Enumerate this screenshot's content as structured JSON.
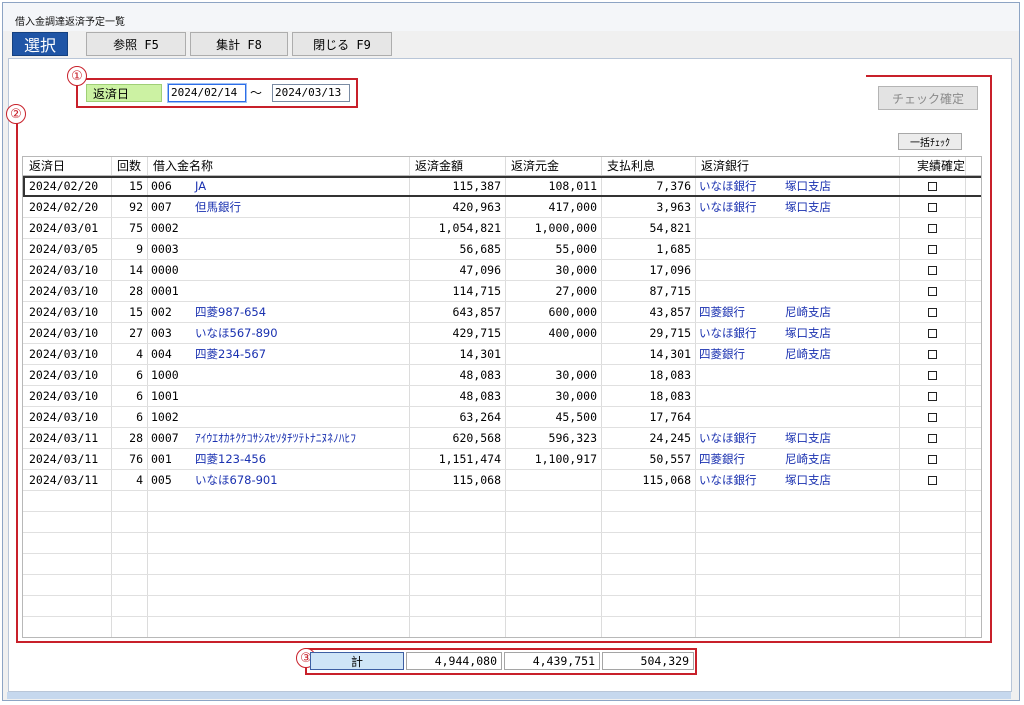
{
  "window": {
    "title": "借入金調達返済予定一覧"
  },
  "toolbar": {
    "select_label": "選択",
    "refer_label": "参照 F5",
    "aggregate_label": "集計 F8",
    "close_label": "閉じる F9"
  },
  "markers": {
    "m1": "①",
    "m2": "②",
    "m3": "③"
  },
  "filter": {
    "label": "返済日",
    "from": "2024/02/14",
    "tilde": "～",
    "to": "2024/03/13"
  },
  "buttons": {
    "check_confirm": "チェック確定",
    "bulk_check": "一括ﾁｪｯｸ"
  },
  "table": {
    "headers": [
      "返済日",
      "回数",
      "借入金名称",
      "返済金額",
      "返済元金",
      "支払利息",
      "返済銀行",
      "実績確定"
    ],
    "rows": [
      {
        "date": "2024/02/20",
        "count": "15",
        "code": "006",
        "name": "JA",
        "amount": "115,387",
        "principal": "108,011",
        "interest": "7,376",
        "bank": "いなほ銀行",
        "branch": "塚口支店"
      },
      {
        "date": "2024/02/20",
        "count": "92",
        "code": "007",
        "name": "但馬銀行",
        "amount": "420,963",
        "principal": "417,000",
        "interest": "3,963",
        "bank": "いなほ銀行",
        "branch": "塚口支店"
      },
      {
        "date": "2024/03/01",
        "count": "75",
        "code": "0002",
        "name": "",
        "amount": "1,054,821",
        "principal": "1,000,000",
        "interest": "54,821",
        "bank": "",
        "branch": ""
      },
      {
        "date": "2024/03/05",
        "count": "9",
        "code": "0003",
        "name": "",
        "amount": "56,685",
        "principal": "55,000",
        "interest": "1,685",
        "bank": "",
        "branch": ""
      },
      {
        "date": "2024/03/10",
        "count": "14",
        "code": "0000",
        "name": "",
        "amount": "47,096",
        "principal": "30,000",
        "interest": "17,096",
        "bank": "",
        "branch": ""
      },
      {
        "date": "2024/03/10",
        "count": "28",
        "code": "0001",
        "name": "",
        "amount": "114,715",
        "principal": "27,000",
        "interest": "87,715",
        "bank": "",
        "branch": ""
      },
      {
        "date": "2024/03/10",
        "count": "15",
        "code": "002",
        "name": "四菱987-654",
        "amount": "643,857",
        "principal": "600,000",
        "interest": "43,857",
        "bank": "四菱銀行",
        "branch": "尼崎支店"
      },
      {
        "date": "2024/03/10",
        "count": "27",
        "code": "003",
        "name": "いなほ567-890",
        "amount": "429,715",
        "principal": "400,000",
        "interest": "29,715",
        "bank": "いなほ銀行",
        "branch": "塚口支店"
      },
      {
        "date": "2024/03/10",
        "count": "4",
        "code": "004",
        "name": "四菱234-567",
        "amount": "14,301",
        "principal": "",
        "interest": "14,301",
        "bank": "四菱銀行",
        "branch": "尼崎支店"
      },
      {
        "date": "2024/03/10",
        "count": "6",
        "code": "1000",
        "name": "",
        "amount": "48,083",
        "principal": "30,000",
        "interest": "18,083",
        "bank": "",
        "branch": ""
      },
      {
        "date": "2024/03/10",
        "count": "6",
        "code": "1001",
        "name": "",
        "amount": "48,083",
        "principal": "30,000",
        "interest": "18,083",
        "bank": "",
        "branch": ""
      },
      {
        "date": "2024/03/10",
        "count": "6",
        "code": "1002",
        "name": "",
        "amount": "63,264",
        "principal": "45,500",
        "interest": "17,764",
        "bank": "",
        "branch": ""
      },
      {
        "date": "2024/03/11",
        "count": "28",
        "code": "0007",
        "name": "ｱｲｳｴｵｶｷｸｹｺｻｼｽｾｿﾀﾁﾂﾃﾄﾅﾆﾇﾈﾉﾊﾋﾌ",
        "amount": "620,568",
        "principal": "596,323",
        "interest": "24,245",
        "bank": "いなほ銀行",
        "branch": "塚口支店"
      },
      {
        "date": "2024/03/11",
        "count": "76",
        "code": "001",
        "name": "四菱123-456",
        "amount": "1,151,474",
        "principal": "1,100,917",
        "interest": "50,557",
        "bank": "四菱銀行",
        "branch": "尼崎支店"
      },
      {
        "date": "2024/03/11",
        "count": "4",
        "code": "005",
        "name": "いなほ678-901",
        "amount": "115,068",
        "principal": "",
        "interest": "115,068",
        "bank": "いなほ銀行",
        "branch": "塚口支店"
      }
    ]
  },
  "totals": {
    "label": "計",
    "amount": "4,944,080",
    "principal": "4,439,751",
    "interest": "504,329"
  },
  "colors": {
    "accent": "#1f55a6",
    "annotation": "#c8202a",
    "date_label_bg": "#ccf2a3",
    "link_text": "#1a31b0"
  }
}
